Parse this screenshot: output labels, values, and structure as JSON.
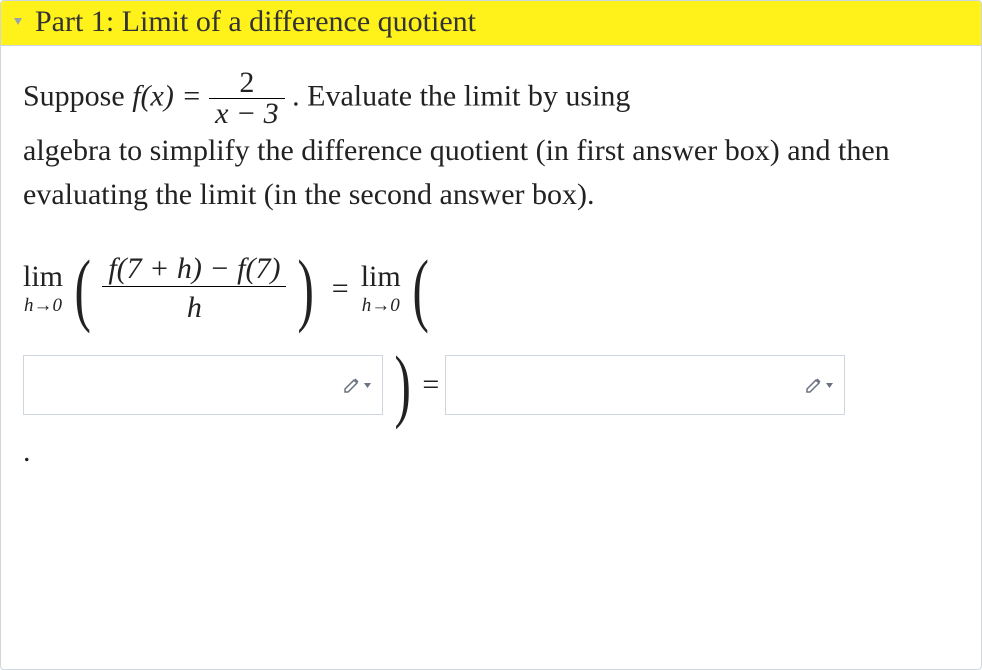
{
  "header": {
    "title": "Part 1: Limit of a difference quotient"
  },
  "prose": {
    "lead1": "Suppose ",
    "fxlabel": "f(x) = ",
    "frac_num": "2",
    "frac_den": "x − 3",
    "after_frac": ". Evaluate the limit by using",
    "para_rest": "algebra to simplify the difference quotient (in first answer box) and then evaluating the limit (in the second answer box)."
  },
  "equation": {
    "lim_label": "lim",
    "lim_sub": "h→0",
    "dq_num": "f(7 + h) − f(7)",
    "dq_den": "h",
    "equals": "=",
    "lim2_label": "lim",
    "lim2_sub": "h→0"
  },
  "period": "."
}
